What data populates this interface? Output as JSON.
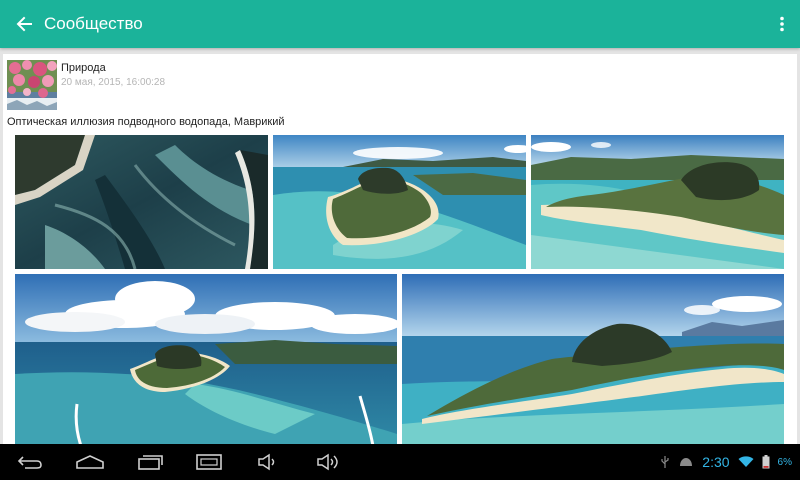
{
  "appbar": {
    "back_icon": "arrow-left-icon",
    "title": "Сообщество",
    "menu_icon": "more-vertical-icon",
    "color": "#1bb39a"
  },
  "post": {
    "author": "Природа",
    "date": "20 мая, 2015, 16:00:28",
    "caption": "Оптическая иллюзия подводного водопада, Маврикий",
    "photos": [
      {
        "name": "photo-1"
      },
      {
        "name": "photo-2"
      },
      {
        "name": "photo-3"
      },
      {
        "name": "photo-4"
      },
      {
        "name": "photo-5"
      }
    ]
  },
  "navbar": {
    "buttons": [
      "back-icon",
      "home-icon",
      "recent-apps-icon",
      "screenshot-icon",
      "volume-down-icon",
      "volume-up-icon"
    ],
    "status_icons": [
      "usb-icon",
      "android-icon",
      "wifi-icon",
      "battery-icon"
    ],
    "time": "2:30",
    "battery": "6%",
    "accent": "#33b5e5"
  }
}
